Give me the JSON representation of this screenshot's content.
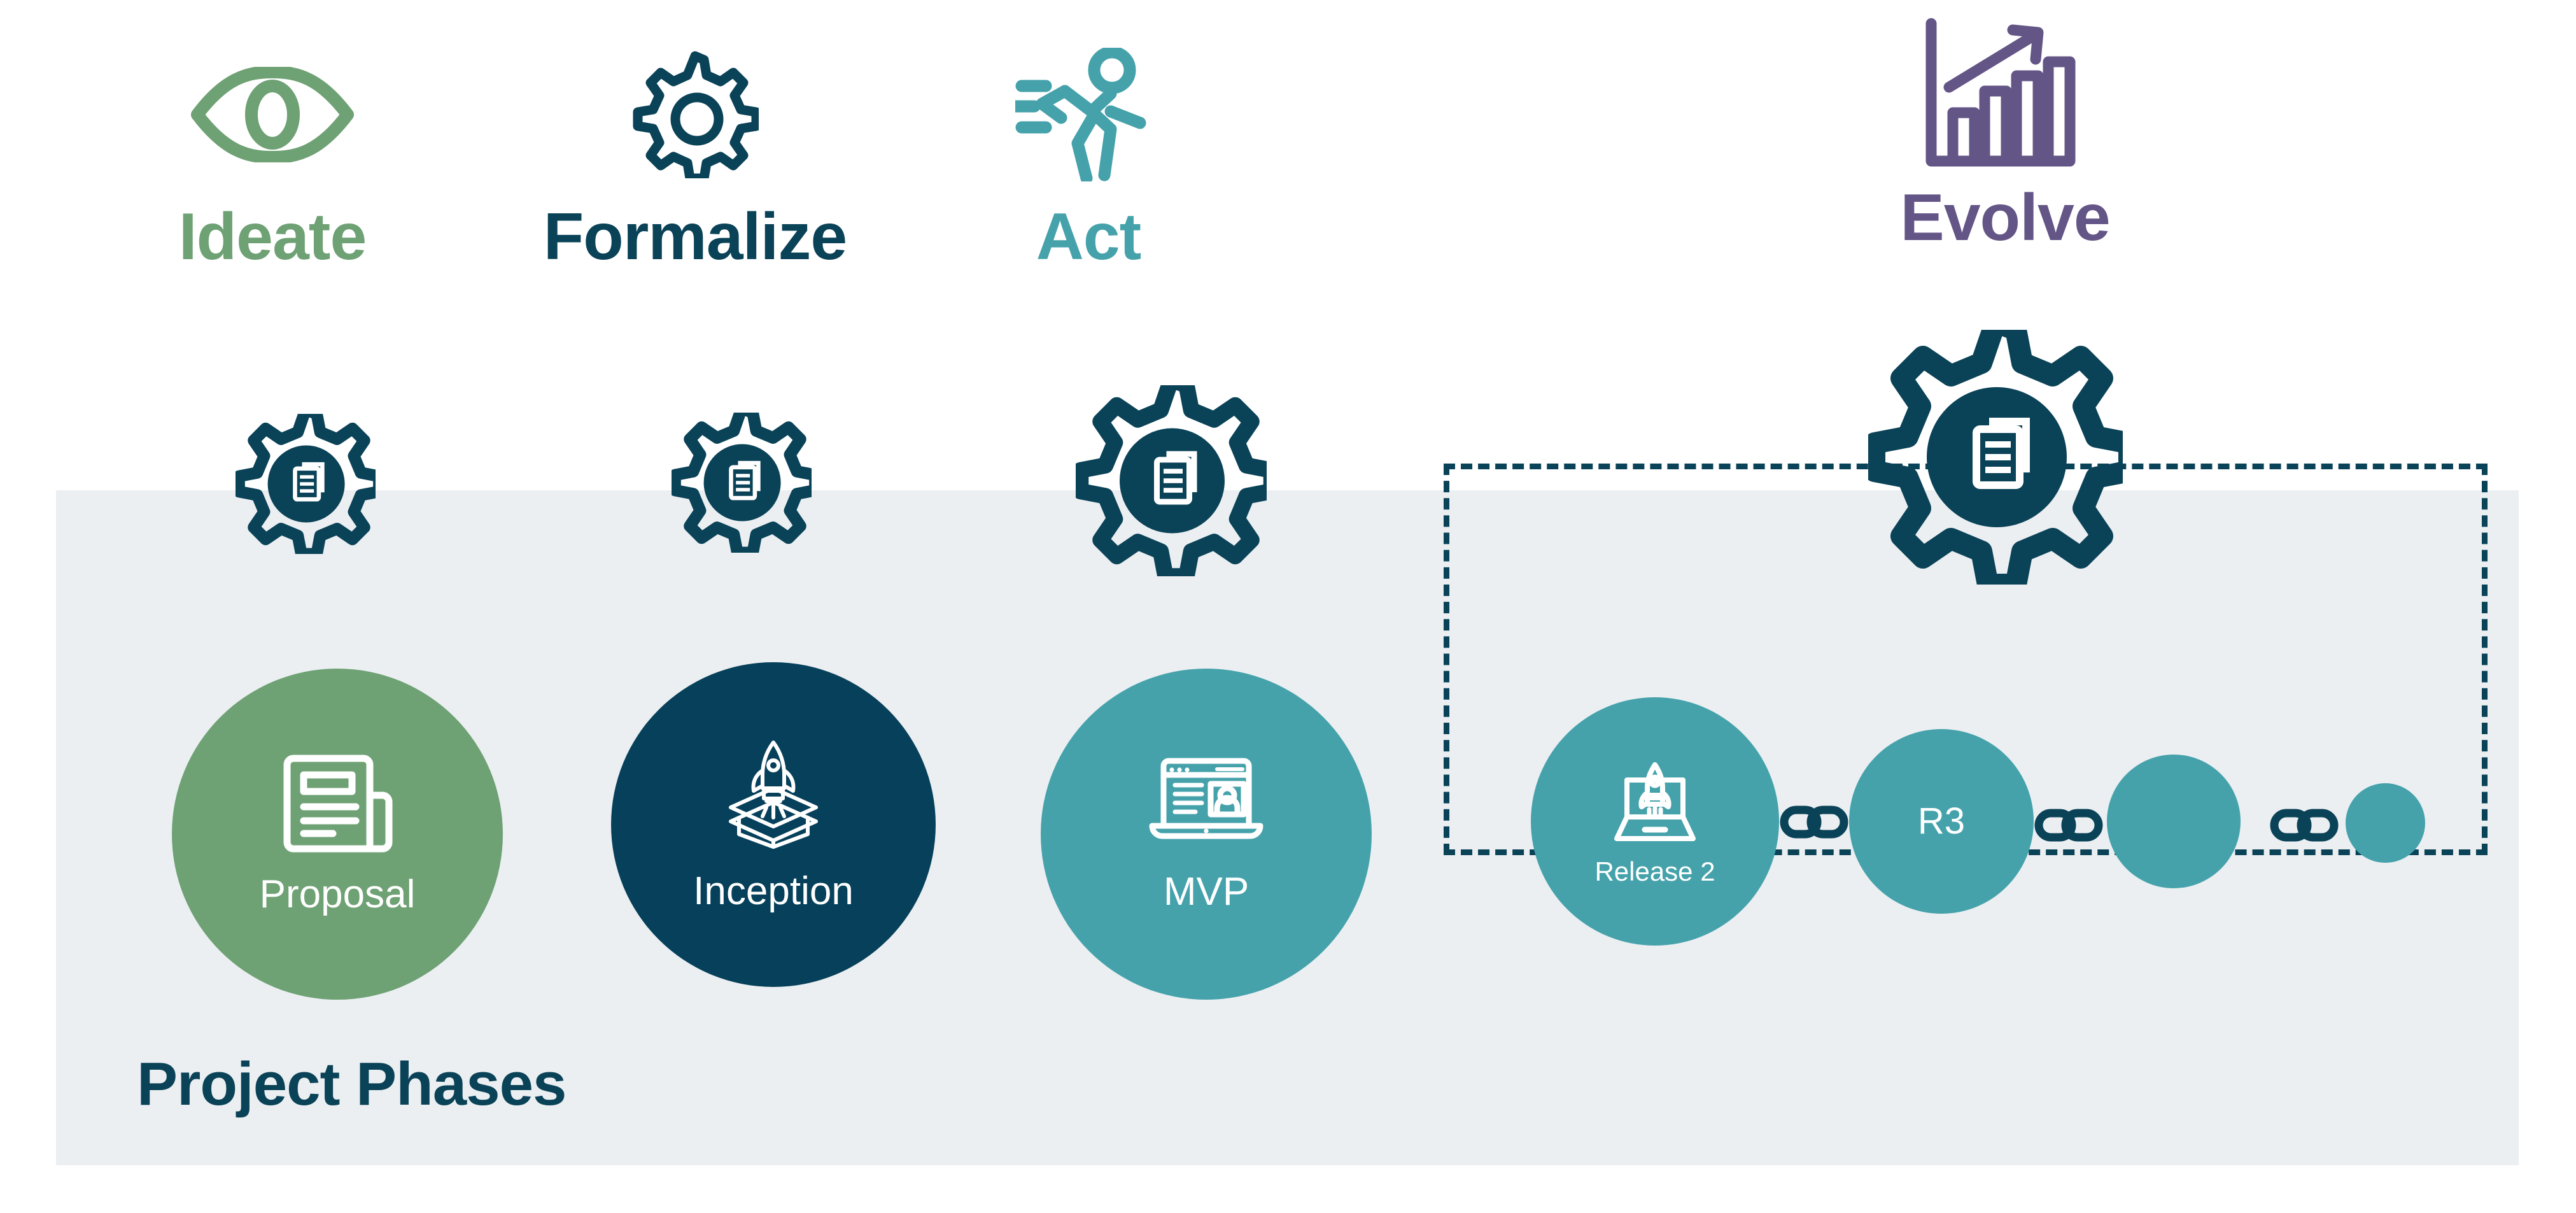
{
  "panel": {
    "caption": "Project Phases",
    "background_color": "#ebeff2"
  },
  "phases": [
    {
      "id": "ideate",
      "label": "Ideate",
      "color": "#6ea173",
      "icon": "eye-icon"
    },
    {
      "id": "formalize",
      "label": "Formalize",
      "color": "#0a4257",
      "icon": "gear-outline-icon"
    },
    {
      "id": "act",
      "label": "Act",
      "color": "#45a2ab",
      "icon": "running-person-icon"
    },
    {
      "id": "evolve",
      "label": "Evolve",
      "color": "#645587",
      "icon": "growth-bar-chart-icon"
    }
  ],
  "gear_badges": [
    {
      "id": "gear-proposal",
      "icon": "gear-documents-icon",
      "color": "#0a4257"
    },
    {
      "id": "gear-inception",
      "icon": "gear-documents-icon",
      "color": "#0a4257"
    },
    {
      "id": "gear-mvp",
      "icon": "gear-documents-icon",
      "color": "#0a4257"
    },
    {
      "id": "gear-evolve",
      "icon": "gear-documents-icon",
      "color": "#0a4257"
    }
  ],
  "milestones": [
    {
      "id": "proposal",
      "label": "Proposal",
      "color": "#6ea173",
      "icon": "newspaper-icon"
    },
    {
      "id": "inception",
      "label": "Inception",
      "color": "#06405a",
      "icon": "rocket-box-icon"
    },
    {
      "id": "mvp",
      "label": "MVP",
      "color": "#45a2ab",
      "icon": "browser-laptop-icon"
    },
    {
      "id": "release2",
      "label": "Release 2",
      "color": "#45a2ab",
      "icon": "rocket-laptop-icon"
    },
    {
      "id": "release3",
      "label": "R3",
      "color": "#45a2ab",
      "icon": ""
    },
    {
      "id": "release4",
      "label": "",
      "color": "#45a2ab",
      "icon": ""
    },
    {
      "id": "release5",
      "label": "",
      "color": "#45a2ab",
      "icon": ""
    }
  ],
  "connectors": [
    {
      "id": "chain-1",
      "icon": "chain-link-icon",
      "color": "#0a4257"
    },
    {
      "id": "chain-2",
      "icon": "chain-link-icon",
      "color": "#0a4257"
    },
    {
      "id": "chain-3",
      "icon": "chain-link-icon",
      "color": "#0a4257"
    }
  ],
  "evolve_frame": {
    "style": "dashed",
    "color": "#0a4257"
  },
  "colors": {
    "green": "#6ea173",
    "navy": "#0a4257",
    "navy_deep": "#06405a",
    "teal": "#45a2ab",
    "purple": "#645587",
    "panel_gray": "#ebeff2",
    "white": "#ffffff"
  }
}
